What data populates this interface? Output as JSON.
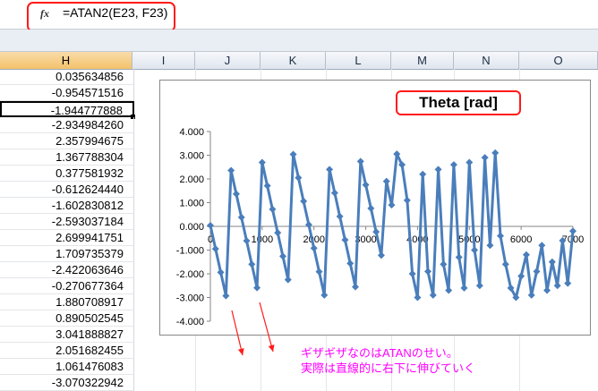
{
  "formula_bar": {
    "fx_label": "fx",
    "formula": "=ATAN2(E23, F23)"
  },
  "columns": [
    "H",
    "I",
    "J",
    "K",
    "L",
    "M",
    "N",
    "O"
  ],
  "selected_column": "H",
  "column_h_values": [
    "0.035634856",
    "-0.954571516",
    "-1.944777888",
    "-2.934984260",
    "2.357994675",
    "1.367788304",
    "0.377581932",
    "-0.612624440",
    "-1.602830812",
    "-2.593037184",
    "2.699941751",
    "1.709735379",
    "-2.422063646",
    "-0.270677364",
    "1.880708917",
    "0.890502545",
    "3.041888827",
    "2.051682455",
    "1.061476083",
    "-3.070322942"
  ],
  "active_row_index": 2,
  "chart_data": {
    "type": "line",
    "title": "Theta [rad]",
    "xlabel": "",
    "ylabel": "",
    "xlim": [
      0,
      7000
    ],
    "ylim": [
      -4,
      4
    ],
    "x_ticks": [
      "0",
      "1000",
      "2000",
      "3000",
      "4000",
      "5000",
      "6000",
      "7000"
    ],
    "y_ticks": [
      "4.000",
      "3.000",
      "2.000",
      "1.000",
      "0.000",
      "-1.000",
      "-2.000",
      "-3.000",
      "-4.000"
    ],
    "series": [
      {
        "color": "#4a7ebb",
        "x": [
          0,
          100,
          200,
          300,
          400,
          500,
          600,
          700,
          800,
          900,
          1000,
          1100,
          1200,
          1300,
          1400,
          1500,
          1600,
          1700,
          1800,
          1900,
          2000,
          2100,
          2200,
          2300,
          2400,
          2500,
          2600,
          2700,
          2800,
          2900,
          3000,
          3100,
          3200,
          3300,
          3400,
          3500,
          3600,
          3700,
          3800,
          3900,
          4000,
          4100,
          4200,
          4300,
          4400,
          4500,
          4600,
          4700,
          4800,
          4900,
          5000,
          5100,
          5200,
          5300,
          5400,
          5500,
          5600,
          5700,
          5800,
          5900,
          6000,
          6100,
          6200,
          6300,
          6400,
          6500,
          6600,
          6700,
          6800,
          6900,
          7000
        ],
        "y": [
          0.04,
          -0.95,
          -1.94,
          -2.93,
          2.36,
          1.37,
          0.38,
          -0.61,
          -1.6,
          -2.59,
          2.7,
          1.71,
          0.72,
          -0.27,
          -1.26,
          -2.25,
          3.04,
          2.05,
          1.06,
          0.07,
          -0.92,
          -1.91,
          -2.9,
          2.4,
          1.41,
          0.42,
          -0.57,
          -1.56,
          -2.55,
          2.74,
          1.75,
          0.76,
          -0.23,
          -1.22,
          1.9,
          0.9,
          3.05,
          2.6,
          1.1,
          -2.0,
          -3.0,
          2.2,
          -1.9,
          -2.9,
          2.4,
          -1.6,
          -2.7,
          2.6,
          -1.3,
          -2.6,
          2.7,
          -1.0,
          -2.5,
          2.9,
          -0.8,
          3.1,
          -0.4,
          -1.6,
          -2.6,
          -3.0,
          -2.1,
          -1.2,
          -2.9,
          -1.9,
          -0.8,
          -2.7,
          -1.5,
          -2.5,
          -0.6,
          -2.4,
          -0.2
        ]
      }
    ]
  },
  "annotation": {
    "line1": "ギザギザなのはATANのせい。",
    "line2": "実際は直線的に右下に伸びていく",
    "color": "#ff00ff"
  },
  "colors": {
    "highlight_red": "#ff1a1a",
    "series_blue": "#4a7ebb"
  }
}
